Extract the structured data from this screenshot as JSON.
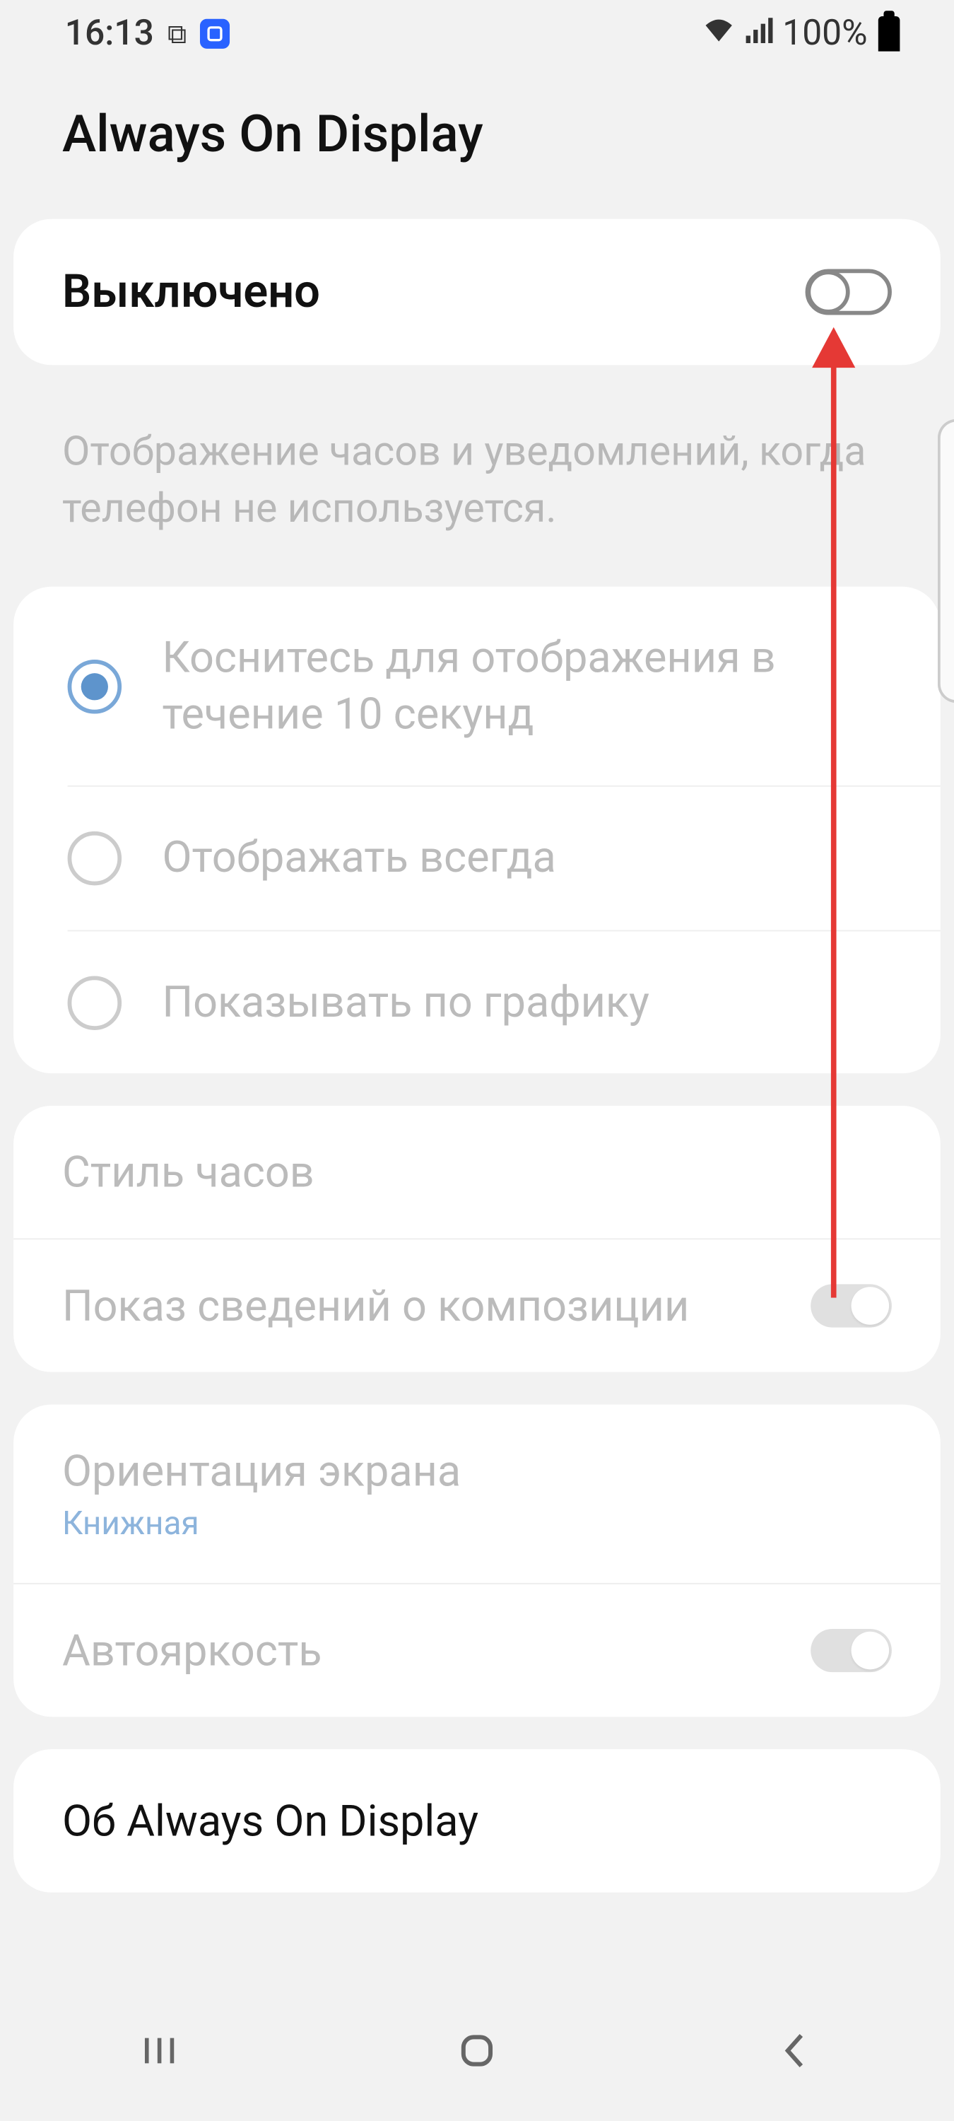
{
  "status": {
    "time": "16:13",
    "battery": "100%"
  },
  "page": {
    "title": "Always On Display"
  },
  "master": {
    "label": "Выключено"
  },
  "description": "Отображение часов и уведомлений, когда телефон не используется.",
  "radio": {
    "options": [
      "Коснитесь для отображения в течение 10 секунд",
      "Отображать всегда",
      "Показывать по графику"
    ]
  },
  "settings": {
    "clock_style": "Стиль часов",
    "music_info": "Показ сведений о композиции",
    "orientation": "Ориентация экрана",
    "orientation_value": "Книжная",
    "auto_brightness": "Автояркость"
  },
  "about": {
    "label": "Об Always On Display"
  }
}
